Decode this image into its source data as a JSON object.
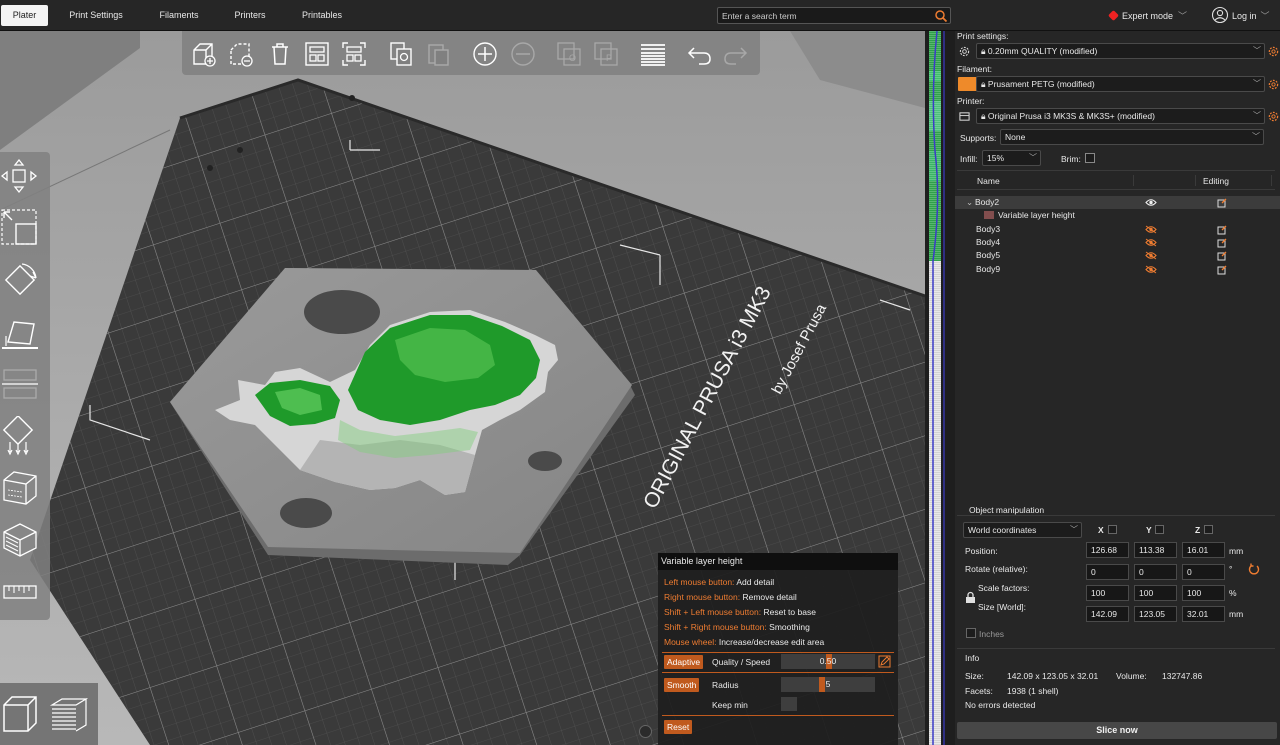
{
  "topbar": {
    "tabs": [
      {
        "label": "Plater",
        "active": true
      },
      {
        "label": "Print Settings",
        "active": false
      },
      {
        "label": "Filaments",
        "active": false
      },
      {
        "label": "Printers",
        "active": false
      },
      {
        "label": "Printables",
        "active": false
      }
    ],
    "search_placeholder": "Enter a search term",
    "mode_label": "Expert mode",
    "mode_color": "#e22222",
    "login_label": "Log in"
  },
  "viewport": {
    "bed_text_line1": "ORIGINAL PRUSA i3 MK3",
    "bed_text_line2": "by Josef Prusa",
    "paint_color": "#1f9a2a"
  },
  "variable_layer_height": {
    "title": "Variable layer height",
    "hints": [
      {
        "key": "Left mouse button:",
        "value": "Add detail"
      },
      {
        "key": "Right mouse button:",
        "value": "Remove detail"
      },
      {
        "key": "Shift + Left mouse button:",
        "value": "Reset to base"
      },
      {
        "key": "Shift + Right mouse button:",
        "value": "Smoothing"
      },
      {
        "key": "Mouse wheel:",
        "value": "Increase/decrease edit area"
      }
    ],
    "adaptive_label": "Adaptive",
    "quality_speed_label": "Quality / Speed",
    "quality_speed_value": "0.50",
    "smooth_label": "Smooth",
    "radius_label": "Radius",
    "radius_value": "5",
    "keep_min_label": "Keep min",
    "reset_label": "Reset",
    "accent_color": "#ee7c31"
  },
  "settings": {
    "print_label": "Print settings:",
    "print_value": "0.20mm QUALITY (modified)",
    "filament_label": "Filament:",
    "filament_value": "Prusament PETG (modified)",
    "filament_color": "#ee8a2a",
    "printer_label": "Printer:",
    "printer_value": "Original Prusa i3 MK3S & MK3S+ (modified)",
    "supports_label": "Supports:",
    "supports_value": "None",
    "infill_label": "Infill:",
    "infill_value": "15%",
    "brim_label": "Brim:"
  },
  "object_list": {
    "col_name": "Name",
    "col_editing": "Editing",
    "items": [
      {
        "name": "Body2",
        "selected": true
      },
      {
        "name": "Variable layer height",
        "child": true
      },
      {
        "name": "Body3"
      },
      {
        "name": "Body4"
      },
      {
        "name": "Body5"
      },
      {
        "name": "Body9"
      }
    ]
  },
  "manipulation": {
    "title": "Object manipulation",
    "coord_system": "World coordinates",
    "x_label": "X",
    "y_label": "Y",
    "z_label": "Z",
    "position_label": "Position:",
    "position": [
      "126.68",
      "113.38",
      "16.01"
    ],
    "position_unit": "mm",
    "rotate_label": "Rotate (relative):",
    "rotate": [
      "0",
      "0",
      "0"
    ],
    "rotate_unit": "°",
    "scale_label": "Scale factors:",
    "scale": [
      "100",
      "100",
      "100"
    ],
    "scale_unit": "%",
    "size_label": "Size [World]:",
    "size": [
      "142.09",
      "123.05",
      "32.01"
    ],
    "size_unit": "mm",
    "inches_label": "Inches"
  },
  "info": {
    "title": "Info",
    "size_label": "Size:",
    "size_value": "142.09 x 123.05 x 32.01",
    "volume_label": "Volume:",
    "volume_value": "132747.86",
    "facets_label": "Facets:",
    "facets_value": "1938 (1 shell)",
    "errors": "No errors detected"
  },
  "slice_label": "Slice now"
}
